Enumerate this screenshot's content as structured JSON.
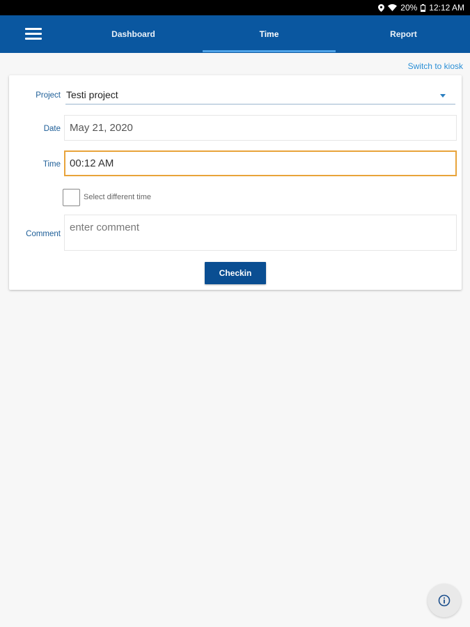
{
  "status_bar": {
    "battery_percent": "20%",
    "time": "12:12 AM",
    "icons": [
      "location-icon",
      "wifi-icon",
      "battery-icon"
    ]
  },
  "nav": {
    "menu_icon": "hamburger-menu-icon",
    "tabs": [
      {
        "label": "Dashboard",
        "active": false
      },
      {
        "label": "Time",
        "active": true
      },
      {
        "label": "Report",
        "active": false
      }
    ],
    "colors": {
      "bar": "#0a57a0",
      "indicator": "#4fa3e8"
    }
  },
  "kiosk_link": "Switch to kiosk",
  "form": {
    "project": {
      "label": "Project",
      "value": "Testi project"
    },
    "date": {
      "label": "Date",
      "value": "May 21, 2020"
    },
    "time": {
      "label": "Time",
      "value": "00:12 AM"
    },
    "different_time": {
      "label": "Select different time",
      "checked": false
    },
    "comment": {
      "label": "Comment",
      "placeholder": "enter comment"
    },
    "submit_label": "Checkin"
  },
  "info_button_icon": "info-icon"
}
